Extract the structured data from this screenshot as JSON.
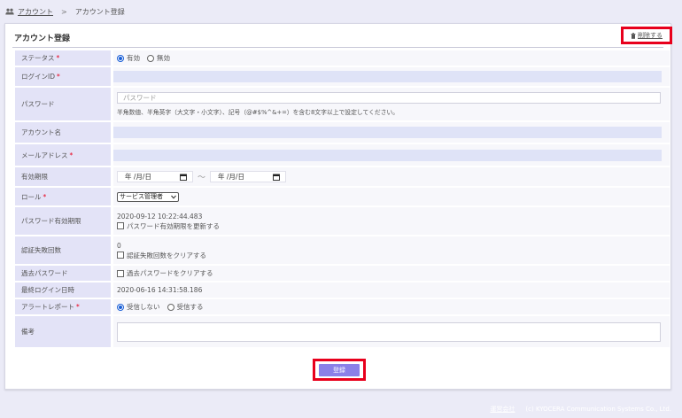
{
  "breadcrumb": {
    "home": "アカウント",
    "separator": ">",
    "current": "アカウント登録"
  },
  "panel": {
    "title": "アカウント登録",
    "delete_label": "削除する"
  },
  "fields": {
    "status": {
      "label": "ステータス",
      "required": "*",
      "options": [
        "有効",
        "無効"
      ],
      "selected": 0
    },
    "login_id": {
      "label": "ログインID",
      "required": "*",
      "value": ""
    },
    "password": {
      "label": "パスワード",
      "placeholder": "パスワード",
      "hint": "半角数値、半角英字（大文字・小文字）、記号（@#$%^&+=）を含む8文字以上で設定してください。"
    },
    "account_name": {
      "label": "アカウント名",
      "value": ""
    },
    "email": {
      "label": "メールアドレス",
      "required": "*",
      "value": ""
    },
    "validity": {
      "label": "有効期限",
      "start": "年 /月/日",
      "end": "年 /月/日",
      "separator": "～"
    },
    "role": {
      "label": "ロール",
      "required": "*",
      "selected": "サービス管理者"
    },
    "password_expiry": {
      "label": "パスワード有効期限",
      "value": "2020-09-12 10:22:44.483",
      "checkbox": "パスワード有効期限を更新する"
    },
    "auth_failures": {
      "label": "認証失敗回数",
      "value": "0",
      "checkbox": "認証失敗回数をクリアする"
    },
    "past_password": {
      "label": "過去パスワード",
      "checkbox": "過去パスワードをクリアする"
    },
    "last_login": {
      "label": "最終ログイン日時",
      "value": "2020-06-16 14:31:58.186"
    },
    "alert_report": {
      "label": "アラートレポート",
      "required": "*",
      "options": [
        "受信しない",
        "受信する"
      ],
      "selected": 0
    },
    "notes": {
      "label": "備考",
      "value": ""
    }
  },
  "submit_label": "登録",
  "footer": {
    "company_link": "運営会社",
    "copyright": "(c) KYOCERA Communication Systems Co., Ltd."
  },
  "colors": {
    "accent": "#8b80e8",
    "highlight": "#e8001c",
    "label_bg": "#e3e3f7",
    "page_bg": "#ebebf7"
  }
}
